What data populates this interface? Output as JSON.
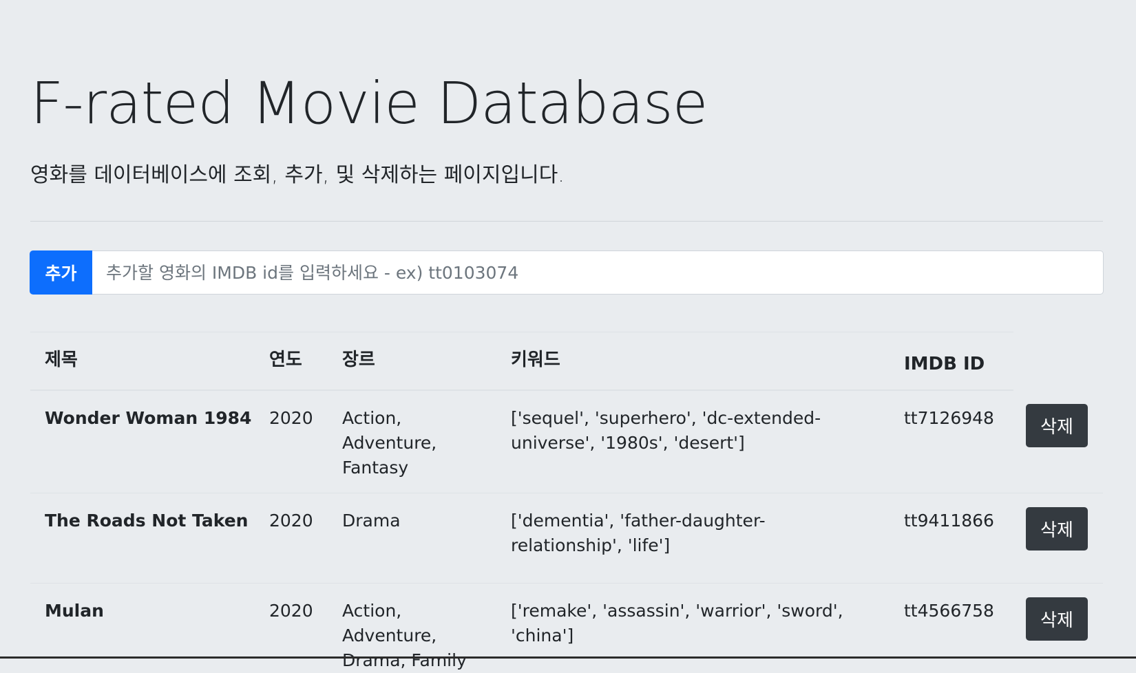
{
  "header": {
    "title": "F-rated Movie Database",
    "subtitle": "영화를 데이터베이스에 조회, 추가, 및 삭제하는 페이지입니다."
  },
  "add_form": {
    "button_label": "추가",
    "input_placeholder": "추가할 영화의 IMDB id를 입력하세요 - ex) tt0103074",
    "input_value": ""
  },
  "table": {
    "headers": {
      "title": "제목",
      "year": "연도",
      "genre": "장르",
      "keywords": "키워드",
      "imdb_id": "IMDB ID"
    },
    "delete_label": "삭제",
    "rows": [
      {
        "title": "Wonder Woman 1984",
        "year": "2020",
        "genre": "Action, Adventure, Fantasy",
        "keywords": "['sequel', 'superhero', 'dc-extended-universe', '1980s', 'desert']",
        "imdb_id": "tt7126948"
      },
      {
        "title": "The Roads Not Taken",
        "year": "2020",
        "genre": "Drama",
        "keywords": "['dementia', 'father-daughter-relationship', 'life']",
        "imdb_id": "tt9411866"
      },
      {
        "title": "Mulan",
        "year": "2020",
        "genre": "Action, Adventure, Drama, Family",
        "keywords": "['remake', 'assassin', 'warrior', 'sword', 'china']",
        "imdb_id": "tt4566758"
      }
    ]
  }
}
